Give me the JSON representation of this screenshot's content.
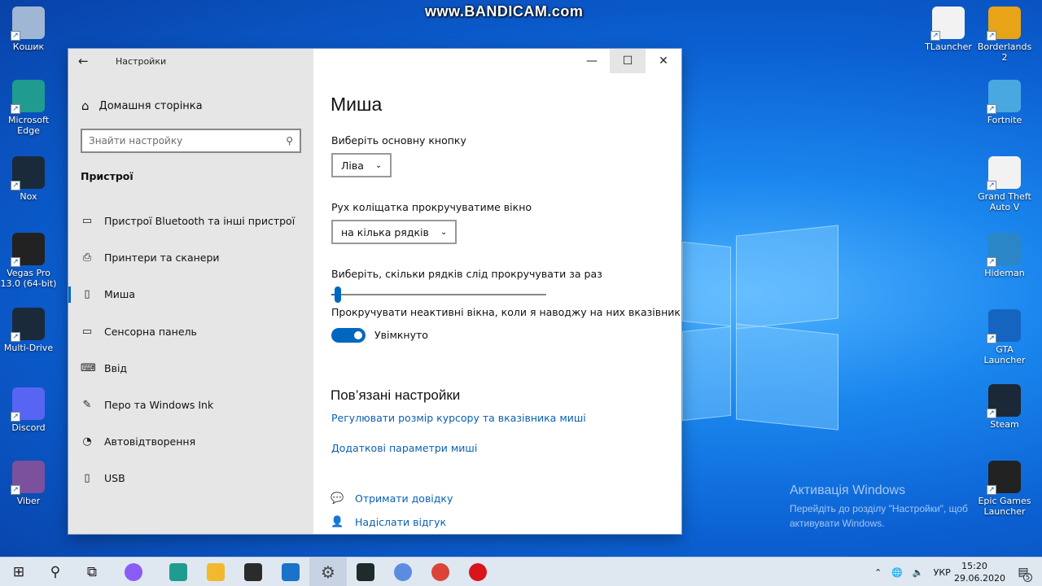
{
  "watermark": "www.BANDICAM.com",
  "desktop": {
    "left_icons": [
      {
        "label": "Кошик",
        "color": "#9fb7d4"
      },
      {
        "label": "Microsoft Edge",
        "color": "#1f9c8f"
      },
      {
        "label": "Nox",
        "color": "#1b2a3a"
      },
      {
        "label": "Vegas Pro 13.0 (64-bit)",
        "color": "#222222"
      },
      {
        "label": "Multi-Drive",
        "color": "#1b2a3a"
      },
      {
        "label": "Discord",
        "color": "#5865f2"
      },
      {
        "label": "Viber",
        "color": "#7b519d"
      }
    ],
    "right_icons": [
      {
        "label": "TLauncher",
        "color": "#f2f2f2"
      },
      {
        "label": "Borderlands 2",
        "color": "#e8a317"
      },
      {
        "label": "Fortnite",
        "color": "#4aa8e0"
      },
      {
        "label": "Grand Theft Auto V",
        "color": "#f2f2f2"
      },
      {
        "label": "Hideman",
        "color": "#2a86c7"
      },
      {
        "label": "GTA Launcher",
        "color": "#1565c0"
      },
      {
        "label": "Steam",
        "color": "#1b2838"
      },
      {
        "label": "Epic Games Launcher",
        "color": "#222222"
      }
    ],
    "activation": {
      "title": "Активація Windows",
      "line1": "Перейдіть до розділу \"Настройки\", щоб",
      "line2": "активувати Windows."
    }
  },
  "window": {
    "title": "Настройки",
    "back_icon": "arrow-left-icon",
    "controls": {
      "minimize": "—",
      "maximize": "☐",
      "close": "✕"
    },
    "sidebar": {
      "home_label": "Домашня сторінка",
      "search_placeholder": "Знайти настройку",
      "section_title": "Пристрої",
      "items": [
        {
          "label": "Пристрої Bluetooth та інші пристрої",
          "icon": "devices-icon"
        },
        {
          "label": "Принтери та сканери",
          "icon": "printer-icon"
        },
        {
          "label": "Миша",
          "icon": "mouse-icon",
          "active": true
        },
        {
          "label": "Сенсорна панель",
          "icon": "touchpad-icon"
        },
        {
          "label": "Ввід",
          "icon": "keyboard-icon"
        },
        {
          "label": "Перо та Windows Ink",
          "icon": "pen-icon"
        },
        {
          "label": "Автовідтворення",
          "icon": "autoplay-icon"
        },
        {
          "label": "USB",
          "icon": "usb-icon"
        }
      ]
    },
    "content": {
      "title": "Миша",
      "primary_button_label": "Виберіть основну кнопку",
      "primary_button_value": "Ліва",
      "scroll_wheel_label": "Рух коліщатка прокручуватиме вікно",
      "scroll_wheel_value": "на кілька рядків",
      "lines_label": "Виберіть, скільки рядків слід прокручувати за раз",
      "lines_slider_fraction": 0.02,
      "inactive_scroll_label": "Прокручувати неактивні вікна, коли я наводжу на них вказівник",
      "inactive_scroll_state": "Увімкнуто",
      "related_title": "Пов’язані настройки",
      "related_links": [
        "Регулювати розмір курсору та вказівника миші",
        "Додаткові параметри миші"
      ],
      "help_links": [
        {
          "label": "Отримати довідку",
          "icon": "help-chat-icon"
        },
        {
          "label": "Надіслати відгук",
          "icon": "feedback-icon"
        }
      ]
    }
  },
  "taskbar": {
    "apps": [
      {
        "name": "start",
        "color": "#1a1a1a"
      },
      {
        "name": "search",
        "color": "#1a1a1a"
      },
      {
        "name": "task-view",
        "color": "#1a1a1a"
      },
      {
        "name": "cortana",
        "color": "#8a5cf6"
      },
      {
        "name": "edge",
        "color": "#1f9c8f"
      },
      {
        "name": "file-explorer",
        "color": "#f2b92f"
      },
      {
        "name": "store",
        "color": "#2b2b2b"
      },
      {
        "name": "mail",
        "color": "#1a73c9"
      },
      {
        "name": "settings",
        "color": "#444444"
      },
      {
        "name": "app-a",
        "color": "#1d2b2b"
      },
      {
        "name": "chromium",
        "color": "#5a8de0"
      },
      {
        "name": "chrome",
        "color": "#db4437"
      },
      {
        "name": "bandicam",
        "color": "#d9141b"
      }
    ],
    "language": "УКР",
    "time": "15:20",
    "date": "29.06.2020",
    "notification_count": "5"
  }
}
